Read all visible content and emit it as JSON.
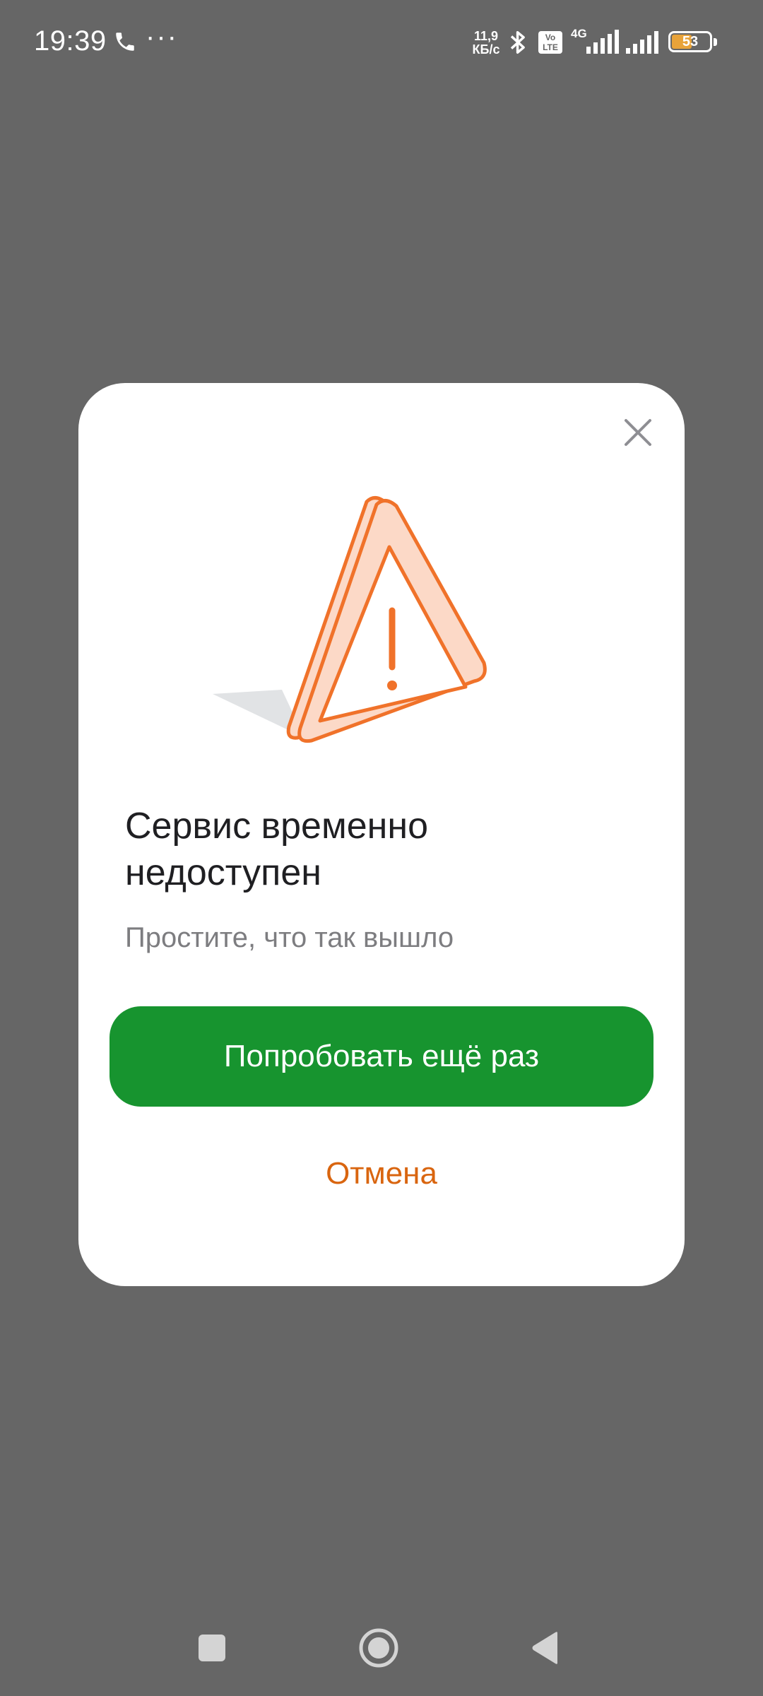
{
  "status_bar": {
    "time": "19:39",
    "more": "···",
    "speed_value": "11,9",
    "speed_unit": "КБ/с",
    "volte": "Vo LTE",
    "network": "4G",
    "battery": "53",
    "battery_level_percent": 53
  },
  "dialog": {
    "title": "Сервис временно недоступен",
    "subtitle": "Простите, что так вышло",
    "retry_label": "Попробовать ещё раз",
    "cancel_label": "Отмена",
    "close_icon": "close-icon",
    "illustration_icon": "warning-triangle-icon"
  },
  "colors": {
    "overlay": "#666666",
    "primary_button": "#17942f",
    "cancel_text": "#d9650f",
    "warning_orange": "#f0722a",
    "warning_fill": "#fcd9c7"
  },
  "nav_bar": {
    "recents_icon": "square-icon",
    "home_icon": "circle-home-icon",
    "back_icon": "triangle-back-icon"
  }
}
